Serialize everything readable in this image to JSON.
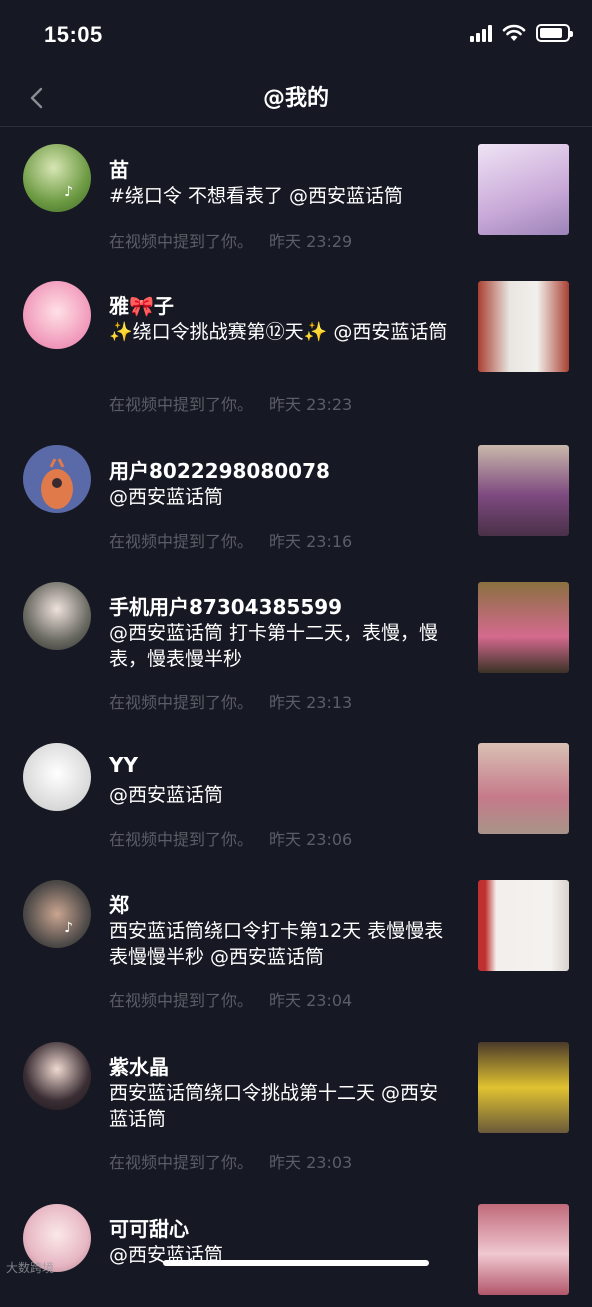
{
  "status_bar": {
    "time": "15:05",
    "icons": [
      "signal-icon",
      "wifi-icon",
      "battery-icon"
    ],
    "battery_level": 0.85
  },
  "nav": {
    "title": "@我的",
    "back_icon": "chevron-left-icon"
  },
  "items": [
    {
      "name": "苗",
      "text": "#绕口令 不想看表了 @西安蓝话筒",
      "meta": "在视频中提到了你。",
      "time": "昨天 23:29",
      "avatar_color": "#5d8b3b",
      "thumb_color": "#d9c3e6"
    },
    {
      "name": "雅🎀子",
      "text": "✨绕口令挑战赛第⑫天✨ @西安蓝话筒",
      "meta": "在视频中提到了你。",
      "time": "昨天 23:23",
      "avatar_color": "#f5b6cf",
      "thumb_color": "#b04a3c"
    },
    {
      "name": "用户8022298080078",
      "text": "@西安蓝话筒",
      "meta": "在视频中提到了你。",
      "time": "昨天 23:16",
      "avatar_color": "#5a6aa8",
      "thumb_color": "#7a4c47"
    },
    {
      "name": "手机用户87304385599",
      "text": "@西安蓝话筒 打卡第十二天，表慢，慢表，慢表慢半秒",
      "meta": "在视频中提到了你。",
      "time": "昨天 23:13",
      "avatar_color": "#3d4a44",
      "thumb_color": "#6b5b3e"
    },
    {
      "name": "YY",
      "text": "@西安蓝话筒",
      "meta": "在视频中提到了你。",
      "time": "昨天 23:06",
      "avatar_color": "#e8e8e8",
      "thumb_color": "#c8a8a0"
    },
    {
      "name": "郑",
      "text": "西安蓝话筒绕口令打卡第12天 表慢慢表 表慢慢半秒 @西安蓝话筒",
      "meta": "在视频中提到了你。",
      "time": "昨天 23:04",
      "avatar_color": "#6e6a66",
      "thumb_color": "#e4e0dc"
    },
    {
      "name": "紫水晶",
      "text": "西安蓝话筒绕口令挑战第十二天 @西安蓝话筒",
      "meta": "在视频中提到了你。",
      "time": "昨天 23:03",
      "avatar_color": "#2a2228",
      "thumb_color": "#8e8a4a"
    },
    {
      "name": "可可甜心",
      "text": "@西安蓝话筒",
      "meta": "",
      "time": "",
      "avatar_color": "#e7c0c8",
      "thumb_color": "#b25a6a"
    }
  ],
  "watermark": "大数跨境"
}
